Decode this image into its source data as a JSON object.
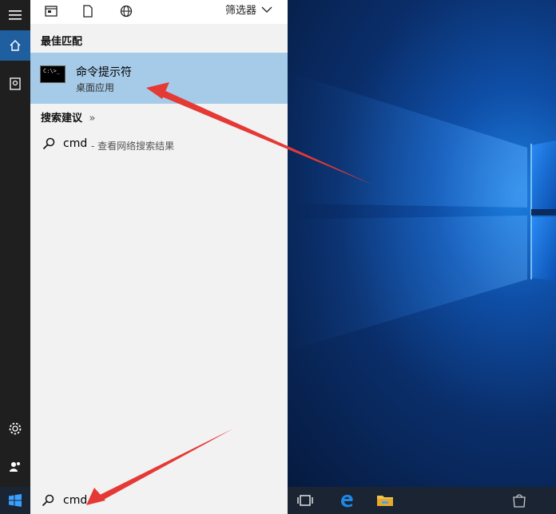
{
  "toolbar": {
    "filter_label": "筛选器",
    "icons": [
      "apps-icon",
      "document-icon",
      "web-icon"
    ]
  },
  "rail": {
    "items": [
      "menu-icon",
      "home-icon",
      "notebook-icon",
      "settings-icon",
      "feedback-icon"
    ]
  },
  "best_match": {
    "section_title": "最佳匹配",
    "app_name": "命令提示符",
    "app_type": "桌面应用",
    "icon_text": "C:\\>_"
  },
  "suggestions": {
    "section_title": "搜索建议",
    "chevron": "»",
    "items": [
      {
        "query": "cmd",
        "description": "- 查看网络搜索结果"
      }
    ]
  },
  "search": {
    "value": "cmd"
  },
  "taskbar": {
    "icons": [
      "task-view-icon",
      "edge-icon",
      "file-explorer-icon",
      "store-icon"
    ]
  },
  "colors": {
    "highlight": "#a6cbe8",
    "rail_active": "#1f5f9f",
    "arrow": "#e53935"
  }
}
